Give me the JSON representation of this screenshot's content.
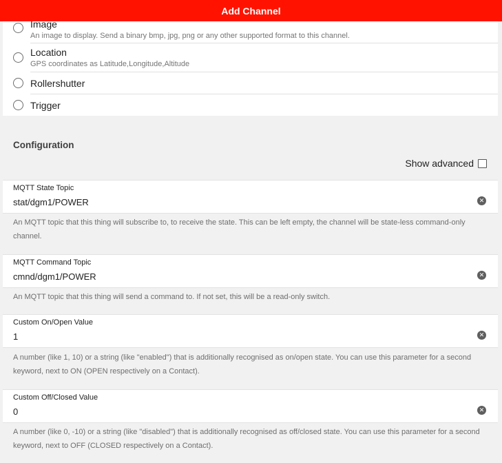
{
  "header": {
    "title": "Add Channel"
  },
  "channel_types": [
    {
      "title": "Image",
      "description": "An image to display. Send a binary bmp, jpg, png or any other supported format to this channel."
    },
    {
      "title": "Location",
      "description": "GPS coordinates as Latitude,Longitude,Altitude"
    },
    {
      "title": "Rollershutter"
    },
    {
      "title": "Trigger"
    }
  ],
  "configuration": {
    "title": "Configuration",
    "show_advanced_label": "Show advanced",
    "show_advanced_checked": false,
    "fields": [
      {
        "label": "MQTT State Topic",
        "value": "stat/dgm1/POWER",
        "help": "An MQTT topic that this thing will subscribe to, to receive the state. This can be left empty, the channel will be state-less command-only channel."
      },
      {
        "label": "MQTT Command Topic",
        "value": "cmnd/dgm1/POWER",
        "help": "An MQTT topic that this thing will send a command to. If not set, this will be a read-only switch."
      },
      {
        "label": "Custom On/Open Value",
        "value": "1",
        "help": "A number (like 1, 10) or a string (like \"enabled\") that is additionally recognised as on/open state. You can use this parameter for a second keyword, next to ON (OPEN respectively on a Contact)."
      },
      {
        "label": "Custom Off/Closed Value",
        "value": "0",
        "help": "A number (like 0, -10) or a string (like \"disabled\") that is additionally recognised as off/closed state. You can use this parameter for a second keyword, next to OFF (CLOSED respectively on a Contact)."
      }
    ]
  },
  "icons": {
    "radio": "radio-unchecked-icon",
    "clear": "clear-circle-icon",
    "checkbox": "checkbox-unchecked-icon"
  },
  "colors": {
    "header_bg": "#ff1300",
    "page_bg": "#f1f1f1"
  }
}
